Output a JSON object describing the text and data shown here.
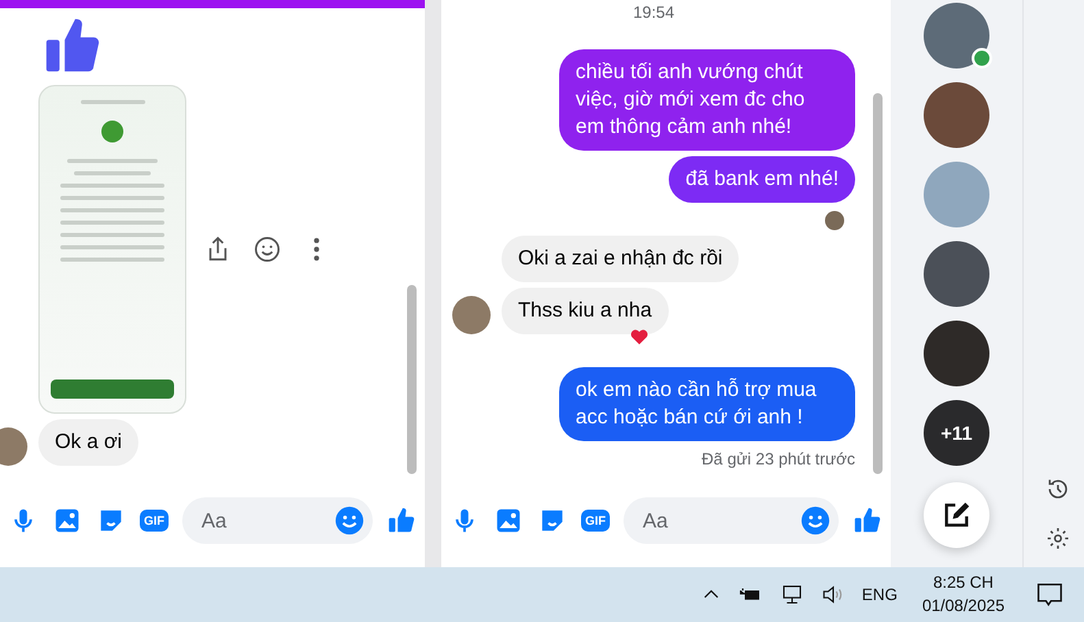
{
  "left_chat": {
    "messages": [
      {
        "kind": "image"
      },
      {
        "kind": "received",
        "text": "Ok a ơi",
        "avatar": true
      }
    ],
    "composer": {
      "placeholder": "Aa",
      "gif_label": "GIF"
    }
  },
  "right_chat": {
    "timestamp": "19:54",
    "messages": [
      {
        "kind": "sent",
        "text": "chiều tối anh vướng chút việc, giờ mới xem đc cho em thông cảm anh nhé!",
        "color": "#8f22ee",
        "seen": false
      },
      {
        "kind": "sent",
        "text": "đã bank em nhé!",
        "color": "#7d2bf4",
        "seen": true
      },
      {
        "kind": "received",
        "text": "Oki a zai e nhận đc rồi",
        "avatar": false,
        "reacted": false
      },
      {
        "kind": "received",
        "text": "Thss kiu a nha",
        "avatar": true,
        "reacted": true
      },
      {
        "kind": "sent",
        "text": "ok em nào cần hỗ trợ mua acc hoặc bán cứ ới anh !",
        "color": "#1b5ef4",
        "seen": false
      }
    ],
    "status": "Đã gửi 23 phút trước",
    "composer": {
      "placeholder": "Aa",
      "gif_label": "GIF"
    }
  },
  "chat_heads": {
    "avatars": [
      {
        "online": true
      },
      {
        "online": false
      },
      {
        "online": false
      },
      {
        "online": false
      },
      {
        "online": false
      }
    ],
    "overflow_count": "+11"
  },
  "taskbar": {
    "language": "ENG",
    "time": "8:25 CH",
    "date": "01/08/2025"
  }
}
